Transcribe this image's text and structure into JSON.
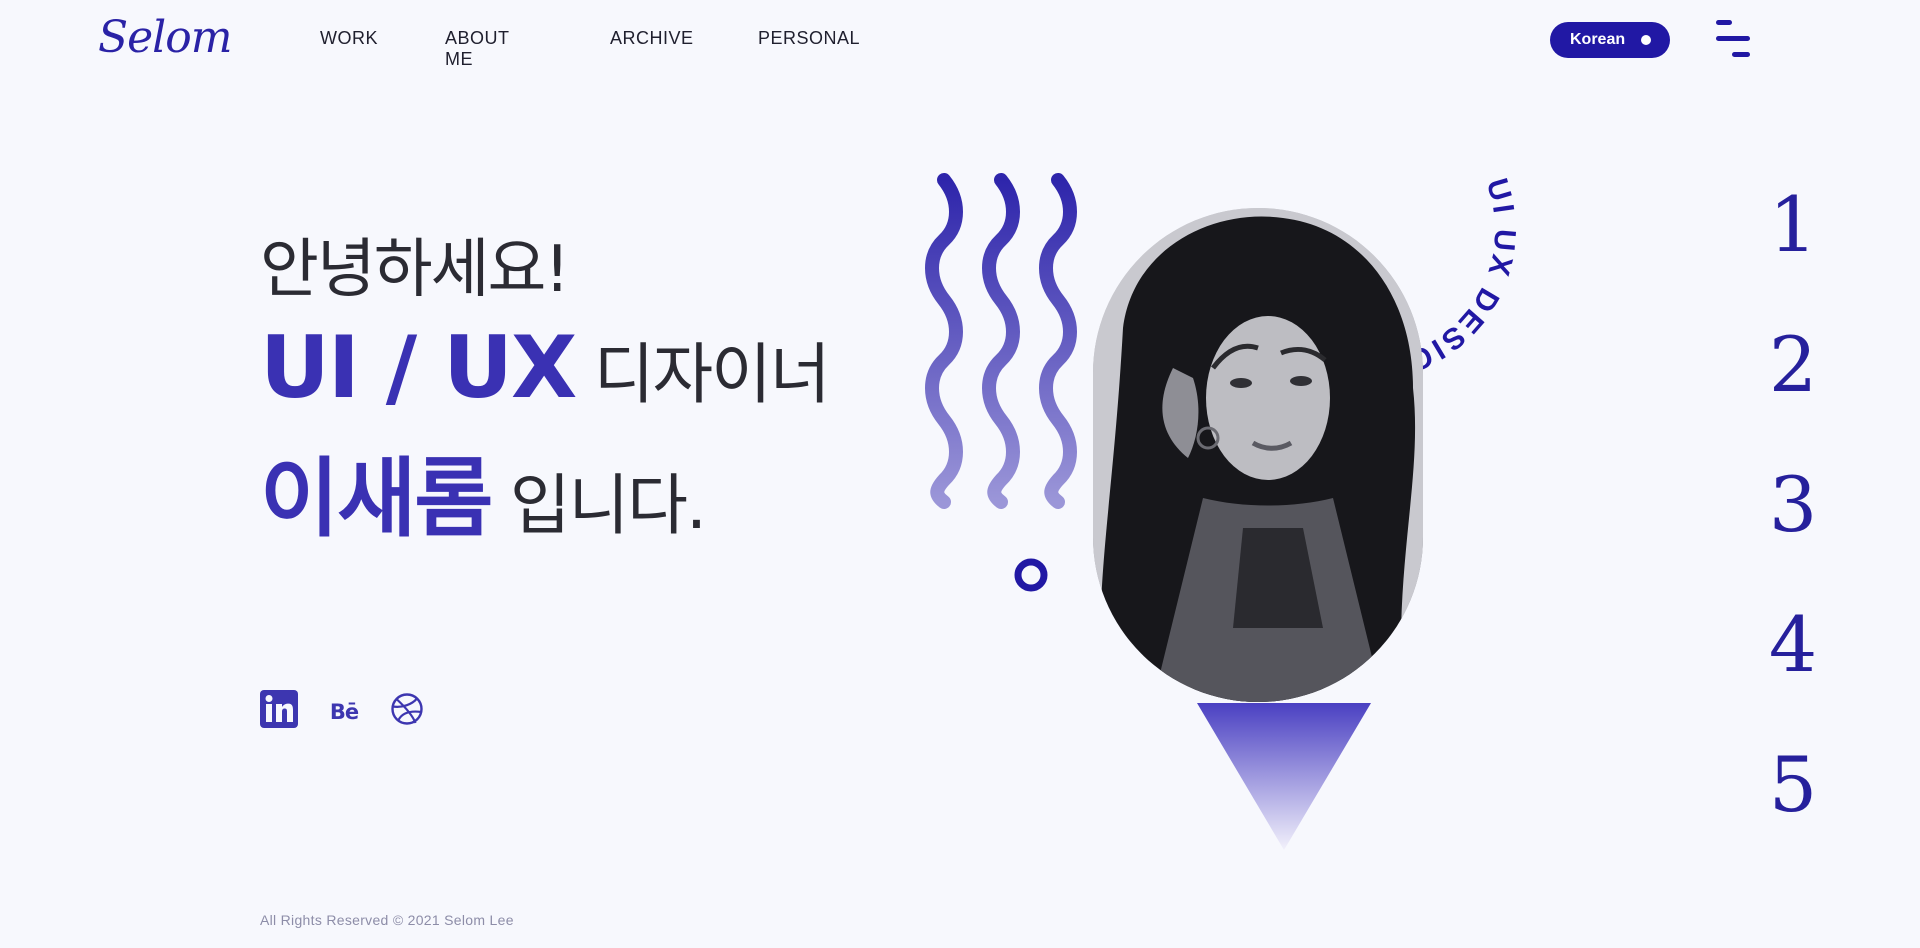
{
  "header": {
    "logo": "Selom",
    "nav": [
      "WORK",
      "ABOUT ME",
      "ARCHIVE",
      "PERSONAL"
    ],
    "language_button": "Korean"
  },
  "hero": {
    "greeting": "안녕하세요!",
    "role_bold": "UI / UX",
    "role_suffix": "디자이너",
    "name_bold": "이새롬",
    "name_suffix": "입니다.",
    "badge_text": "UI UX DESIGNER UI UX DESIGNER"
  },
  "socials": [
    "linkedin-icon",
    "behance-icon",
    "dribbble-icon"
  ],
  "behance_label": "Bē",
  "pager": [
    "1",
    "2",
    "3",
    "4",
    "5"
  ],
  "footer": "All Rights Reserved © 2021 Selom Lee",
  "colors": {
    "brand": "#2118a4",
    "accent": "#3a31b3",
    "background": "#f7f8fd",
    "text": "#2b2b33"
  }
}
